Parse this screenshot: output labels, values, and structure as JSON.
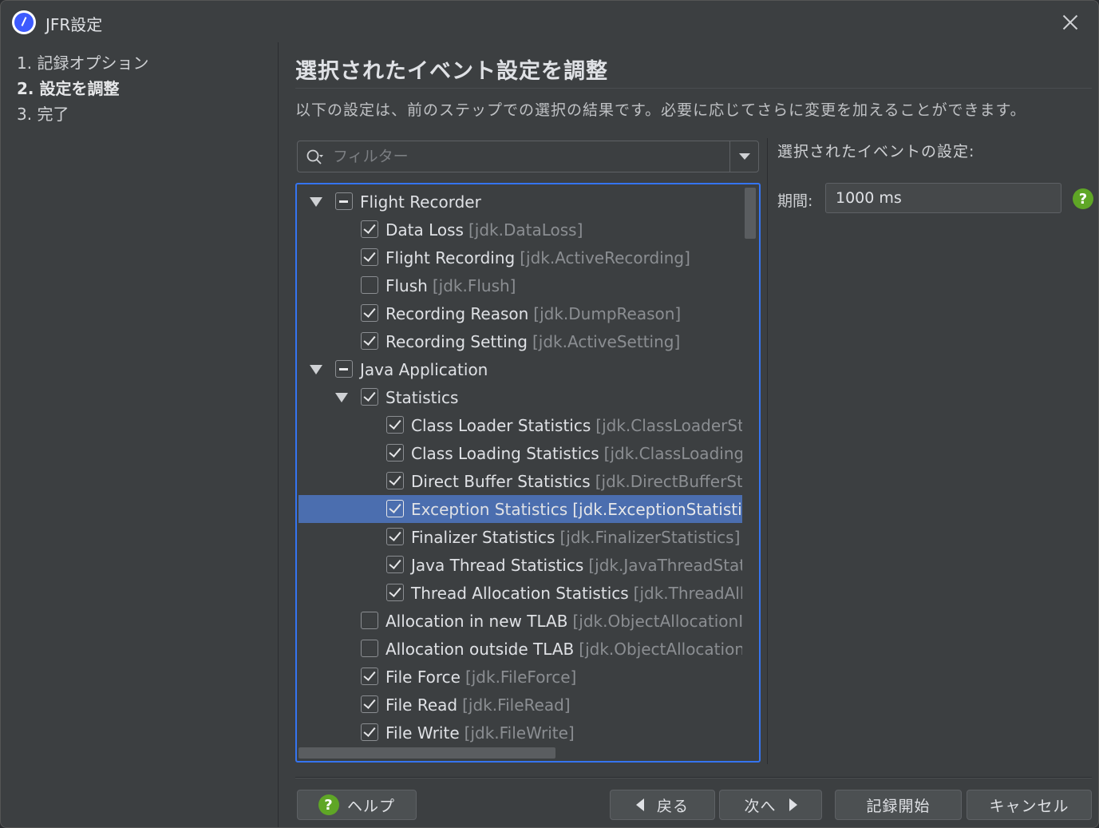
{
  "window": {
    "title": "JFR設定"
  },
  "steps": [
    "1. 記録オプション",
    "2. 設定を調整",
    "3. 完了"
  ],
  "main": {
    "heading": "選択されたイベント設定を調整",
    "description": "以下の設定は、前のステップでの選択の結果です。必要に応じてさらに変更を加えることができます。",
    "filter_placeholder": "フィルター"
  },
  "tree": [
    {
      "level": 0,
      "expandable": true,
      "state": "partial",
      "label": "Flight Recorder",
      "id": ""
    },
    {
      "level": 1,
      "expandable": false,
      "state": "checked",
      "label": "Data Loss",
      "id": "[jdk.DataLoss]"
    },
    {
      "level": 1,
      "expandable": false,
      "state": "checked",
      "label": "Flight Recording",
      "id": "[jdk.ActiveRecording]"
    },
    {
      "level": 1,
      "expandable": false,
      "state": "unchecked",
      "label": "Flush",
      "id": "[jdk.Flush]"
    },
    {
      "level": 1,
      "expandable": false,
      "state": "checked",
      "label": "Recording Reason",
      "id": "[jdk.DumpReason]"
    },
    {
      "level": 1,
      "expandable": false,
      "state": "checked",
      "label": "Recording Setting",
      "id": "[jdk.ActiveSetting]"
    },
    {
      "level": 0,
      "expandable": true,
      "state": "partial",
      "label": "Java Application",
      "id": ""
    },
    {
      "level": 1,
      "expandable": true,
      "state": "checked",
      "label": "Statistics",
      "id": ""
    },
    {
      "level": 2,
      "expandable": false,
      "state": "checked",
      "label": "Class Loader Statistics",
      "id": "[jdk.ClassLoaderStatisti"
    },
    {
      "level": 2,
      "expandable": false,
      "state": "checked",
      "label": "Class Loading Statistics",
      "id": "[jdk.ClassLoadingStat"
    },
    {
      "level": 2,
      "expandable": false,
      "state": "checked",
      "label": "Direct Buffer Statistics",
      "id": "[jdk.DirectBufferStatist"
    },
    {
      "level": 2,
      "expandable": false,
      "state": "checked",
      "label": "Exception Statistics",
      "id": "[jdk.ExceptionStatistics]",
      "selected": true
    },
    {
      "level": 2,
      "expandable": false,
      "state": "checked",
      "label": "Finalizer Statistics",
      "id": "[jdk.FinalizerStatistics]"
    },
    {
      "level": 2,
      "expandable": false,
      "state": "checked",
      "label": "Java Thread Statistics",
      "id": "[jdk.JavaThreadStatistic"
    },
    {
      "level": 2,
      "expandable": false,
      "state": "checked",
      "label": "Thread Allocation Statistics",
      "id": "[jdk.ThreadAlloca"
    },
    {
      "level": 1,
      "expandable": false,
      "state": "unchecked",
      "label": "Allocation in new TLAB",
      "id": "[jdk.ObjectAllocationInN"
    },
    {
      "level": 1,
      "expandable": false,
      "state": "unchecked",
      "label": "Allocation outside TLAB",
      "id": "[jdk.ObjectAllocationOu"
    },
    {
      "level": 1,
      "expandable": false,
      "state": "checked",
      "label": "File Force",
      "id": "[jdk.FileForce]"
    },
    {
      "level": 1,
      "expandable": false,
      "state": "checked",
      "label": "File Read",
      "id": "[jdk.FileRead]"
    },
    {
      "level": 1,
      "expandable": false,
      "state": "checked",
      "label": "File Write",
      "id": "[jdk.FileWrite]"
    }
  ],
  "side": {
    "title": "選択されたイベントの設定:",
    "period_label": "期間:",
    "period_value": "1000 ms"
  },
  "buttons": {
    "help": "ヘルプ",
    "back": "戻る",
    "next": "次へ",
    "start": "記録開始",
    "cancel": "キャンセル"
  },
  "colors": {
    "accent": "#3574f0",
    "selection": "#4b6eaf",
    "help_green": "#5fa626"
  }
}
